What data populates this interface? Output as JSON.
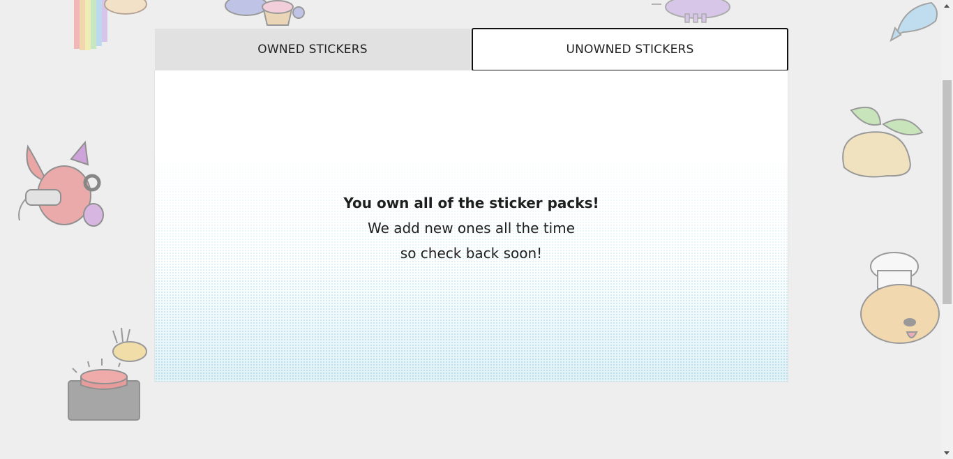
{
  "tabs": {
    "owned_label": "OWNED STICKERS",
    "unowned_label": "UNOWNED STICKERS",
    "active": "unowned"
  },
  "message": {
    "headline": "You own all of the sticker packs!",
    "line1": "We add new ones all the time",
    "line2": "so check back soon!"
  },
  "decorations": [
    "rainbow-sticker",
    "cupcake-creature-sticker",
    "purple-blob-sticker",
    "dolphin-sticker",
    "gamer-bird-sticker",
    "sprout-bulb-sticker",
    "chef-dog-sticker",
    "button-box-sticker"
  ],
  "colors": {
    "background": "#eeeeee",
    "tab_inactive": "#e1e1e1",
    "tab_active_border": "#111111",
    "panel_dots": "#b2deec"
  }
}
